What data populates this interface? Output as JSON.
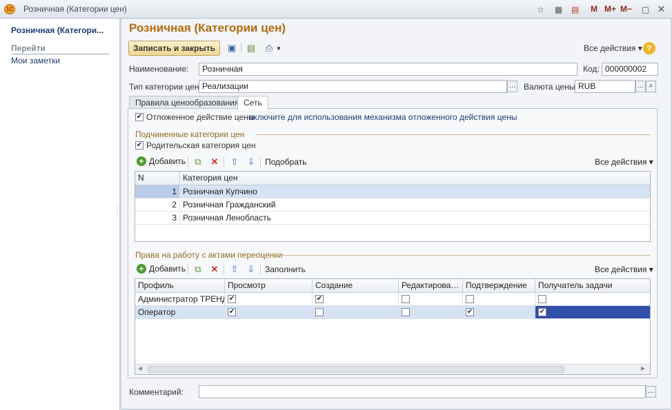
{
  "window": {
    "title": "Розничная (Категории цен)",
    "logo": "1С",
    "toolbar_icons": [
      "bookmark-icon",
      "calculator-icon",
      "calendar-icon",
      "minimize-icon",
      "close-icon"
    ],
    "memory_buttons": [
      "M",
      "M+",
      "M−"
    ]
  },
  "sidebar": {
    "title": "Розничная (Категори...",
    "goto_header": "Перейти",
    "items": [
      "Мои заметки"
    ]
  },
  "form": {
    "title": "Розничная (Категории цен)",
    "save_close": "Записать и закрыть",
    "all_actions": "Все действия",
    "name_label": "Наименование:",
    "name_value": "Розничная",
    "code_label": "Код:",
    "code_value": "000000002",
    "type_label": "Тип категории цен:",
    "type_value": "Реализации",
    "currency_label": "Валюта цены:",
    "currency_value": "RUB",
    "tabs": [
      "Правила ценообразования",
      "Сеть"
    ],
    "deferred_label": "Отложенное действие цены",
    "deferred_link": "включите для использования механизма отложенного действия цены",
    "sub_section": "Подчиненные категории цен",
    "parent_label": "Родительская категория цен",
    "add": "Добавить",
    "pick": "Подобрать",
    "fill": "Заполнить",
    "cat_headers": [
      "N",
      "Категория цен"
    ],
    "categories": [
      {
        "n": "1",
        "name": "Розничная Купчино"
      },
      {
        "n": "2",
        "name": "Розничная Гражданский"
      },
      {
        "n": "3",
        "name": "Розничная Ленобласть"
      }
    ],
    "rights_section": "Права на работу с актами переоценки",
    "rights_headers": [
      "Профиль",
      "Просмотр",
      "Создание",
      "Редактирован...",
      "Подтверждение",
      "Получатель задачи"
    ],
    "rights": [
      {
        "profile": "Администратор ТРЕНД",
        "checks": [
          true,
          true,
          false,
          false,
          false
        ]
      },
      {
        "profile": "Оператор",
        "checks": [
          true,
          false,
          false,
          true,
          true
        ]
      }
    ],
    "comment_label": "Комментарий:",
    "comment_value": ""
  },
  "colors": {
    "title": "#b36b0e",
    "link": "#1d3b71",
    "selection": "#d5e3f4",
    "active_cell": "#2f4fa8"
  }
}
